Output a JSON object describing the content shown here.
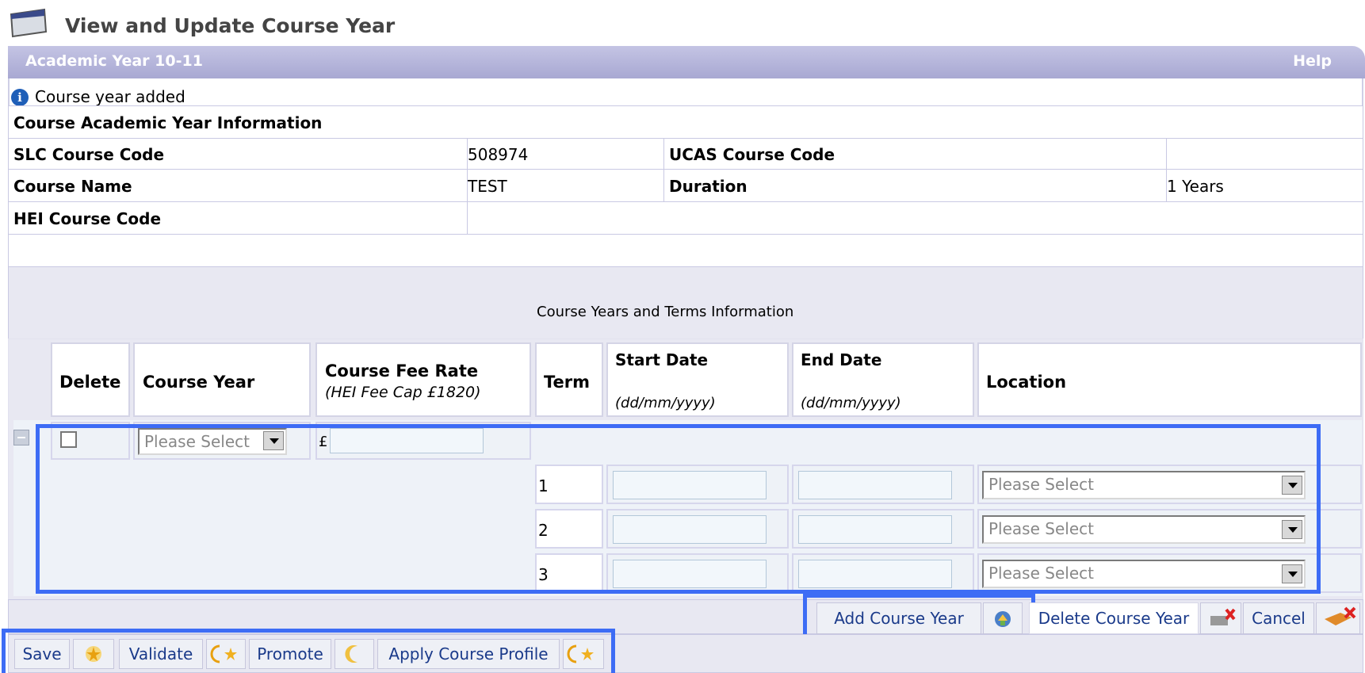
{
  "page": {
    "title": "View and Update Course Year"
  },
  "header": {
    "title": "Academic Year 10-11",
    "help": "Help"
  },
  "message": {
    "text": "Course year added"
  },
  "info": {
    "section_title": "Course Academic Year Information",
    "slc_label": "SLC Course Code",
    "slc_value": "508974",
    "ucas_label": "UCAS Course Code",
    "ucas_value": "",
    "name_label": "Course Name",
    "name_value": "TEST",
    "duration_label": "Duration",
    "duration_value": "1 Years",
    "hei_label": "HEI Course Code",
    "hei_value": ""
  },
  "terms_section": {
    "title": "Course Years and Terms Information",
    "columns": {
      "delete": "Delete",
      "course_year": "Course Year",
      "fee_rate": "Course Fee Rate",
      "fee_cap": "(HEI Fee Cap £1820)",
      "term": "Term",
      "start_date": "Start Date",
      "start_fmt": "(dd/mm/yyyy)",
      "end_date": "End Date",
      "end_fmt": "(dd/mm/yyyy)",
      "location": "Location"
    },
    "row": {
      "course_year_select": "Please Select",
      "currency": "£",
      "fee_value": "",
      "terms": [
        {
          "term": "1",
          "start": "",
          "end": "",
          "location": "Please Select"
        },
        {
          "term": "2",
          "start": "",
          "end": "",
          "location": "Please Select"
        },
        {
          "term": "3",
          "start": "",
          "end": "",
          "location": "Please Select"
        }
      ]
    }
  },
  "actions": {
    "add_course_year": "Add Course Year",
    "delete_course_year": "Delete Course Year",
    "cancel": "Cancel"
  },
  "footer": {
    "save": "Save",
    "validate": "Validate",
    "promote": "Promote",
    "apply_profile": "Apply Course Profile"
  }
}
